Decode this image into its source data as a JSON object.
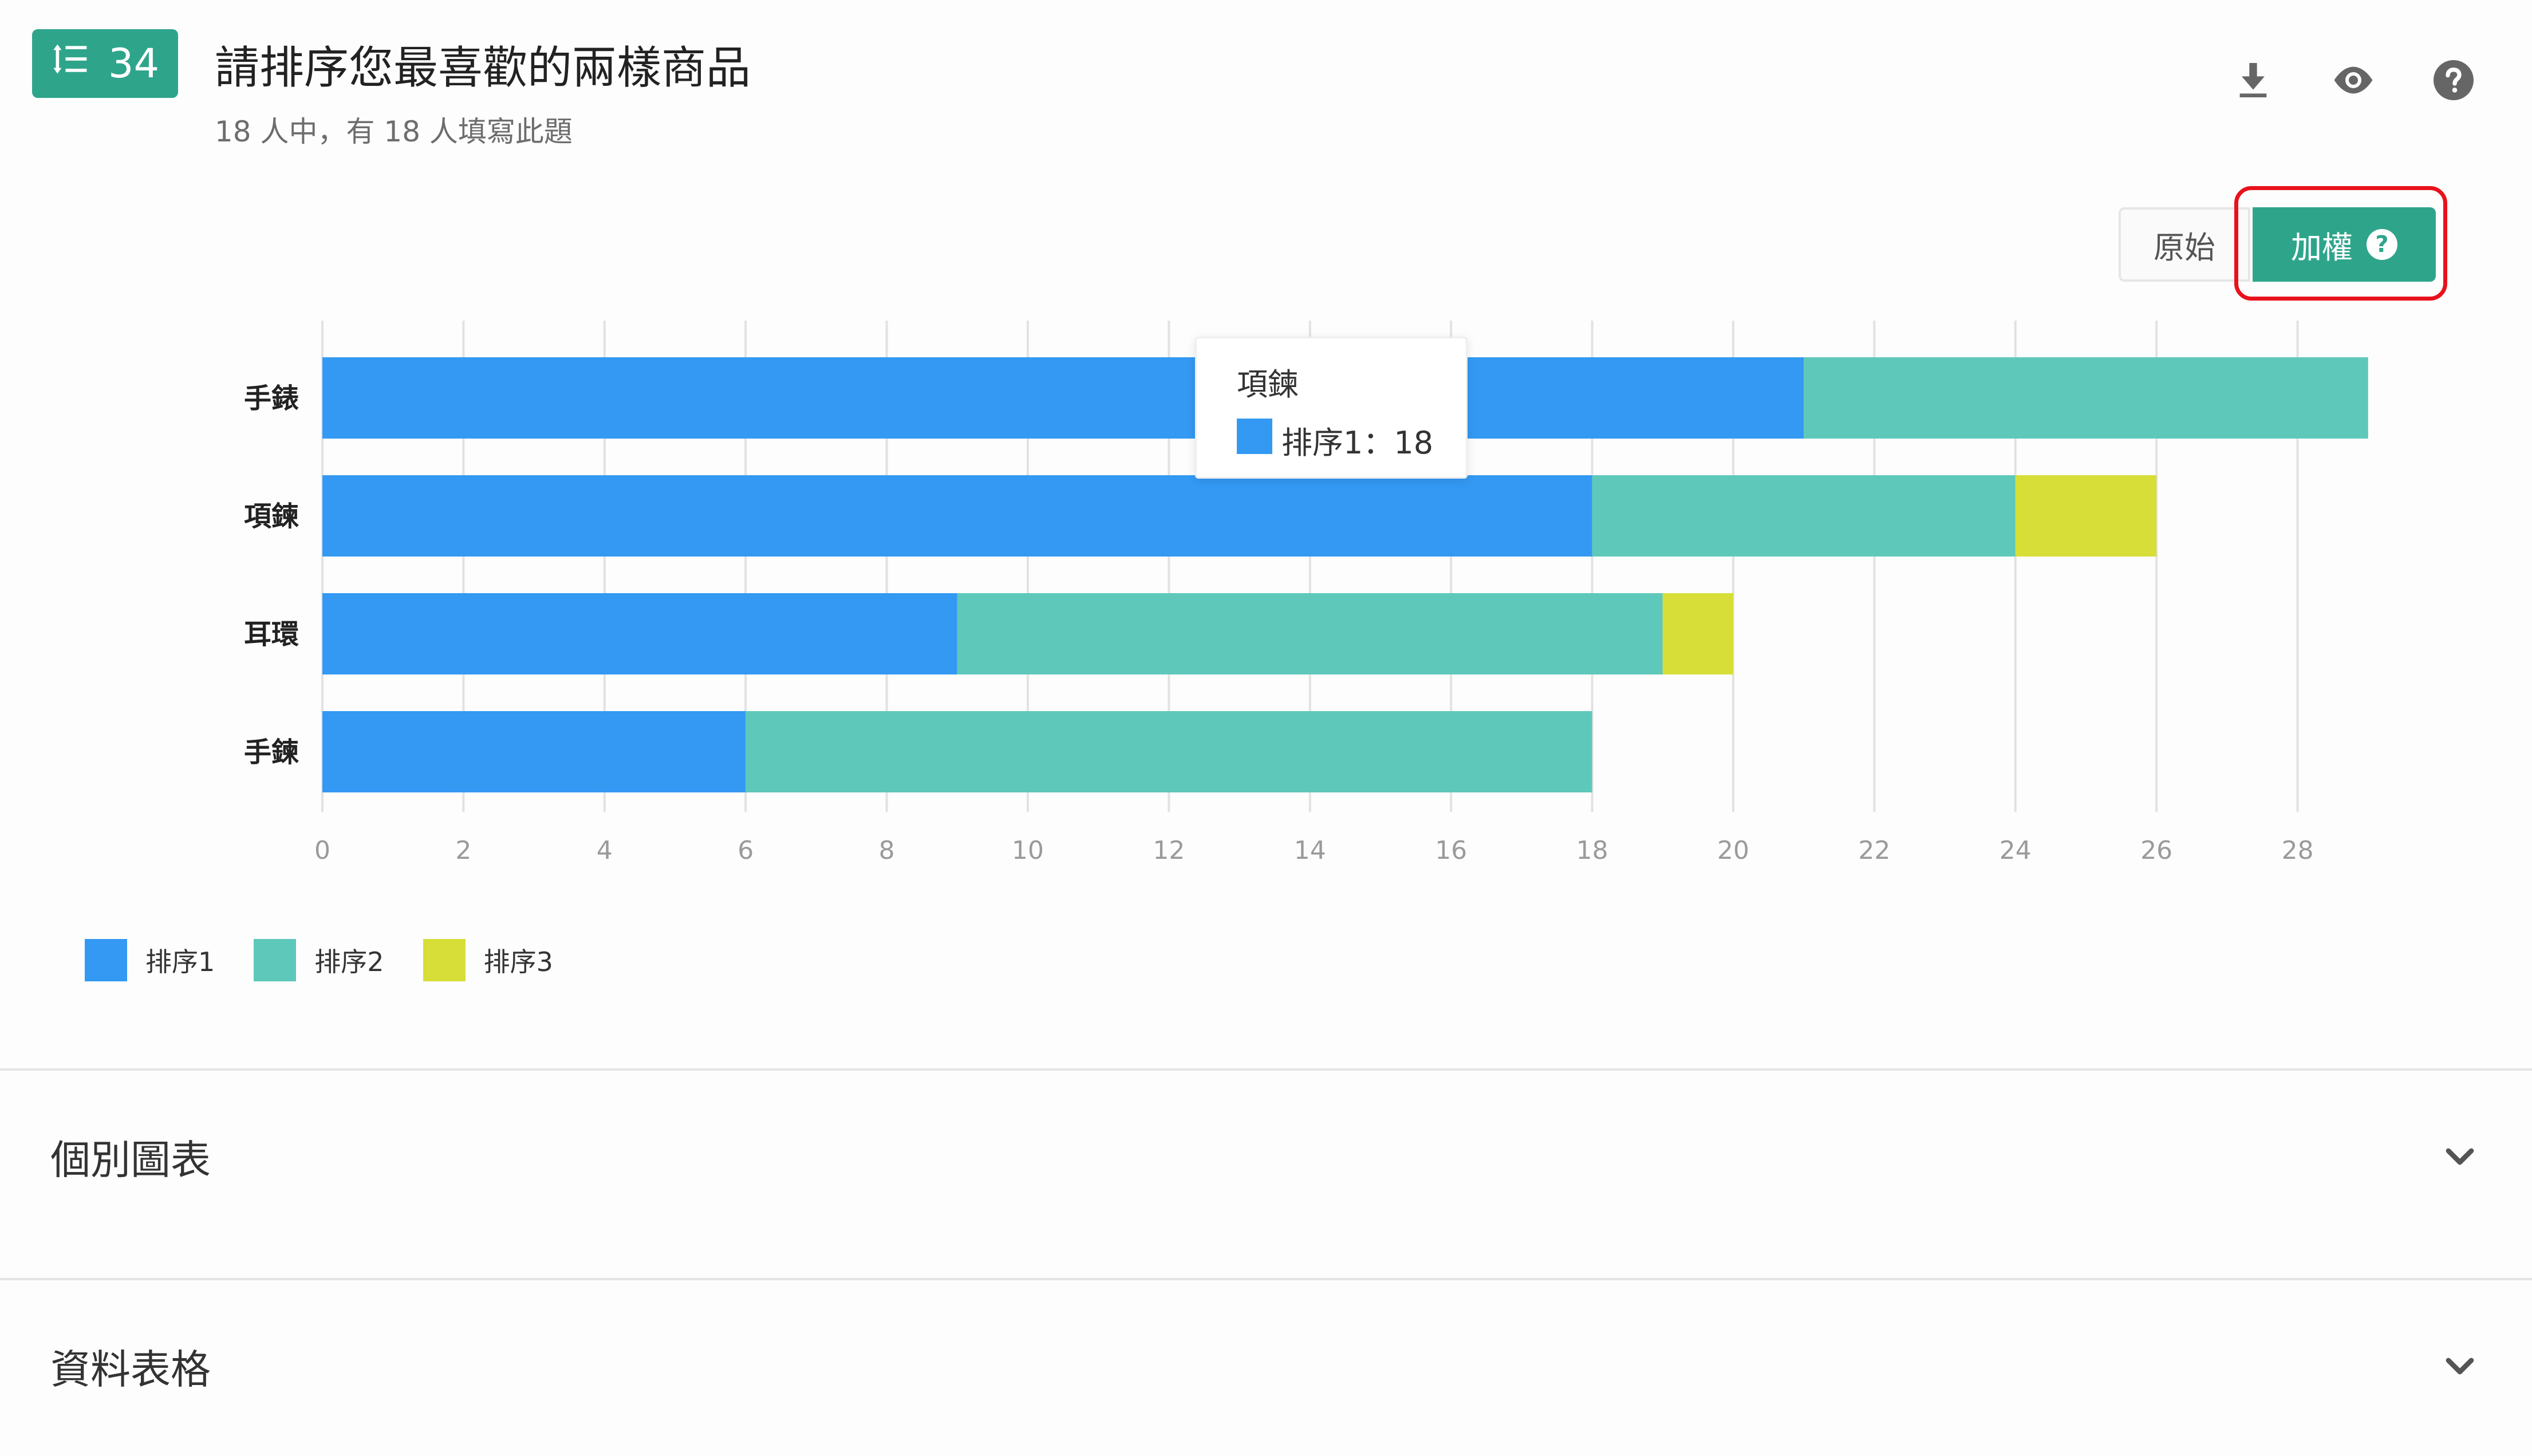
{
  "header": {
    "badge_number": "34",
    "title": "請排序您最喜歡的兩樣商品",
    "subtitle": "18 人中，有 18 人填寫此題",
    "actions": [
      "download-icon",
      "eye-icon",
      "help-icon"
    ]
  },
  "view_toggle": {
    "raw_label": "原始",
    "weighted_label": "加權",
    "weighted_help": "?",
    "selected": "加權"
  },
  "tooltip": {
    "title": "項鍊",
    "value": "排序1：18",
    "color": "#3399f3"
  },
  "colors": {
    "accent": "#2ea58b",
    "highlight": "#e8121c"
  },
  "chart_data": {
    "type": "bar",
    "orientation": "horizontal",
    "stacked": true,
    "categories": [
      "手錶",
      "項鍊",
      "耳環",
      "手鍊"
    ],
    "series": [
      {
        "name": "排序1",
        "color": "#3399f3",
        "values": [
          21,
          18,
          9,
          6
        ]
      },
      {
        "name": "排序2",
        "color": "#5ec8ba",
        "values": [
          8,
          6,
          10,
          12
        ]
      },
      {
        "name": "排序3",
        "color": "#d6de37",
        "values": [
          0,
          2,
          1,
          0
        ]
      }
    ],
    "xlim": [
      0,
      29
    ],
    "xticks": [
      "0",
      "2",
      "4",
      "6",
      "8",
      "10",
      "12",
      "14",
      "16",
      "18",
      "20",
      "22",
      "24",
      "26",
      "28"
    ],
    "grid": true,
    "legend": "bottom-left"
  },
  "sections": [
    {
      "label": "個別圖表"
    },
    {
      "label": "資料表格"
    }
  ]
}
